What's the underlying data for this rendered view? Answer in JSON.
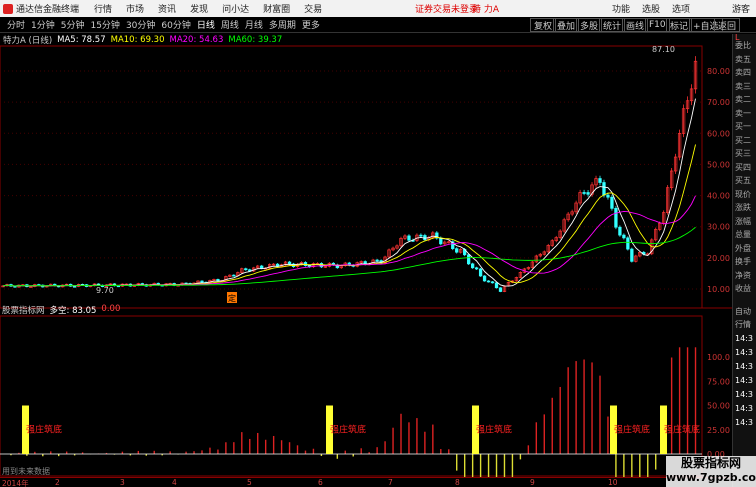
{
  "menubar": {
    "app_title": "通达信金融终端",
    "items": [
      "行情",
      "市场",
      "资讯",
      "发现",
      "问小达",
      "财富圈",
      "交易"
    ],
    "warning": "证券交易未登录",
    "stock": "特 力A",
    "right_items": [
      "功能",
      "选股",
      "选项"
    ],
    "guest": "游客"
  },
  "toolbar": {
    "periods": [
      "分时",
      "1分钟",
      "5分钟",
      "15分钟",
      "30分钟",
      "60分钟",
      "日线",
      "周线",
      "月线",
      "多周期",
      "更多"
    ],
    "active_period": "日线",
    "buttons": [
      "复权",
      "叠加",
      "多股",
      "统计",
      "画线",
      "F10",
      "标记",
      "+自选",
      "返回"
    ]
  },
  "info": {
    "stock_label": "特力A (日线)",
    "ma5": "MA5: 78.57",
    "ma10": "MA10: 69.30",
    "ma20": "MA20: 54.63",
    "ma60": "MA60: 39.37"
  },
  "price_axis": [
    "80.00",
    "70.00",
    "60.00",
    "50.00",
    "40.00",
    "30.00",
    "20.00",
    "10.00"
  ],
  "price_annotations": {
    "high": "87.10",
    "low": "9.70",
    "marker": "定"
  },
  "sub_indicator": {
    "name": "股票指标网",
    "label": "多空: 83.05",
    "value": "0.00",
    "axis": [
      "100.0",
      "75.00",
      "50.00",
      "25.00",
      "0.00"
    ],
    "signal_text": "强庄筑底"
  },
  "right_panel": {
    "labels": [
      "委比",
      "卖五",
      "卖四",
      "卖三",
      "卖二",
      "卖一",
      "买一",
      "买二",
      "买三",
      "买四",
      "买五",
      "现价",
      "涨跌",
      "涨幅",
      "总量",
      "外盘",
      "换手",
      "净资",
      "收益"
    ],
    "bottom_labels": [
      "自动",
      "行情"
    ],
    "times": [
      "14:3",
      "14:3",
      "14:3",
      "14:3",
      "14:3",
      "14:3",
      "14:3"
    ],
    "corner": "L"
  },
  "footer": {
    "note": "用到未来数据"
  },
  "time_axis": [
    "2014年",
    "2",
    "3",
    "4",
    "5",
    "6",
    "7",
    "8",
    "9",
    "10"
  ],
  "watermark": {
    "line1": "股票指标网",
    "line2": "www.7gpzb.com"
  },
  "colors": {
    "up": "#ff3333",
    "down": "#33ffff",
    "ma5": "#ffffff",
    "ma10": "#ffff00",
    "ma20": "#ff00ff",
    "ma60": "#00ff00",
    "signal_bar": "#ffff33"
  }
}
